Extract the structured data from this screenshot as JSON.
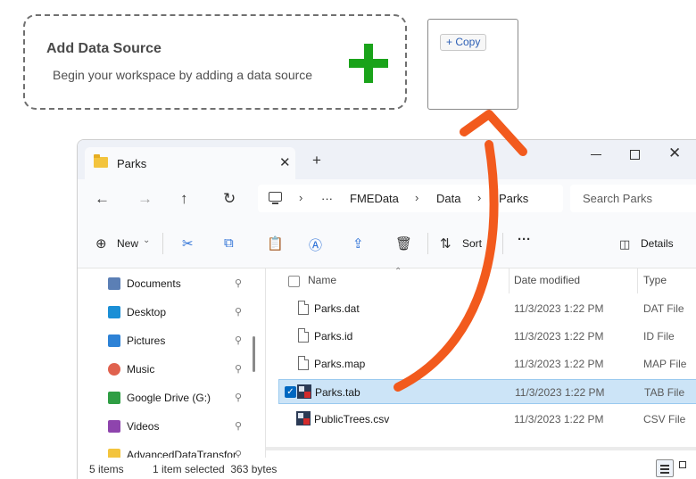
{
  "add_source": {
    "title": "Add Data Source",
    "subtitle": "Begin your workspace by adding a data source"
  },
  "drop_target": {
    "badge": "+ Copy"
  },
  "explorer": {
    "tab_title": "Parks",
    "tab_close": "✕",
    "new_tab": "+",
    "win_close": "✕",
    "nav": {
      "back": "←",
      "forward": "→",
      "up": "↑",
      "refresh": "↻"
    },
    "breadcrumb": {
      "more": "···",
      "sep": "›",
      "items": [
        "FMEData",
        "Data",
        "Parks"
      ]
    },
    "search_placeholder": "Search Parks",
    "toolbar": {
      "new_label": "New",
      "sort_label": "Sort",
      "more": "···",
      "details_label": "Details"
    },
    "sidebar": {
      "items": [
        {
          "label": "Documents",
          "icon": "documents-icon",
          "color": "#5b7fb5"
        },
        {
          "label": "Desktop",
          "icon": "desktop-icon",
          "color": "#1b8fd6"
        },
        {
          "label": "Pictures",
          "icon": "pictures-icon",
          "color": "#2d82d6"
        },
        {
          "label": "Music",
          "icon": "music-icon",
          "color": "#e0624e"
        },
        {
          "label": "Google Drive (G:)",
          "icon": "google-drive-icon",
          "color": "#2f9e44"
        },
        {
          "label": "Videos",
          "icon": "videos-icon",
          "color": "#8e44ad"
        },
        {
          "label": "AdvancedDataTransfor",
          "icon": "folder-icon",
          "color": "#f3c43d"
        }
      ],
      "pin": "📌"
    },
    "columns": {
      "name": "Name",
      "date": "Date modified",
      "type": "Type"
    },
    "files": [
      {
        "name": "Parks.dat",
        "date": "11/3/2023 1:22 PM",
        "type": "DAT File",
        "selected": false
      },
      {
        "name": "Parks.id",
        "date": "11/3/2023 1:22 PM",
        "type": "ID File",
        "selected": false
      },
      {
        "name": "Parks.map",
        "date": "11/3/2023 1:22 PM",
        "type": "MAP File",
        "selected": false
      },
      {
        "name": "Parks.tab",
        "date": "11/3/2023 1:22 PM",
        "type": "TAB File",
        "selected": true
      },
      {
        "name": "PublicTrees.csv",
        "date": "11/3/2023 1:22 PM",
        "type": "CSV File",
        "selected": false
      }
    ],
    "status": {
      "items": "5 items",
      "selection": "1 item selected  363 bytes"
    }
  },
  "colors": {
    "plus": "#1aa31a",
    "arrow": "#f25a1d",
    "selection": "#cce4f7"
  }
}
